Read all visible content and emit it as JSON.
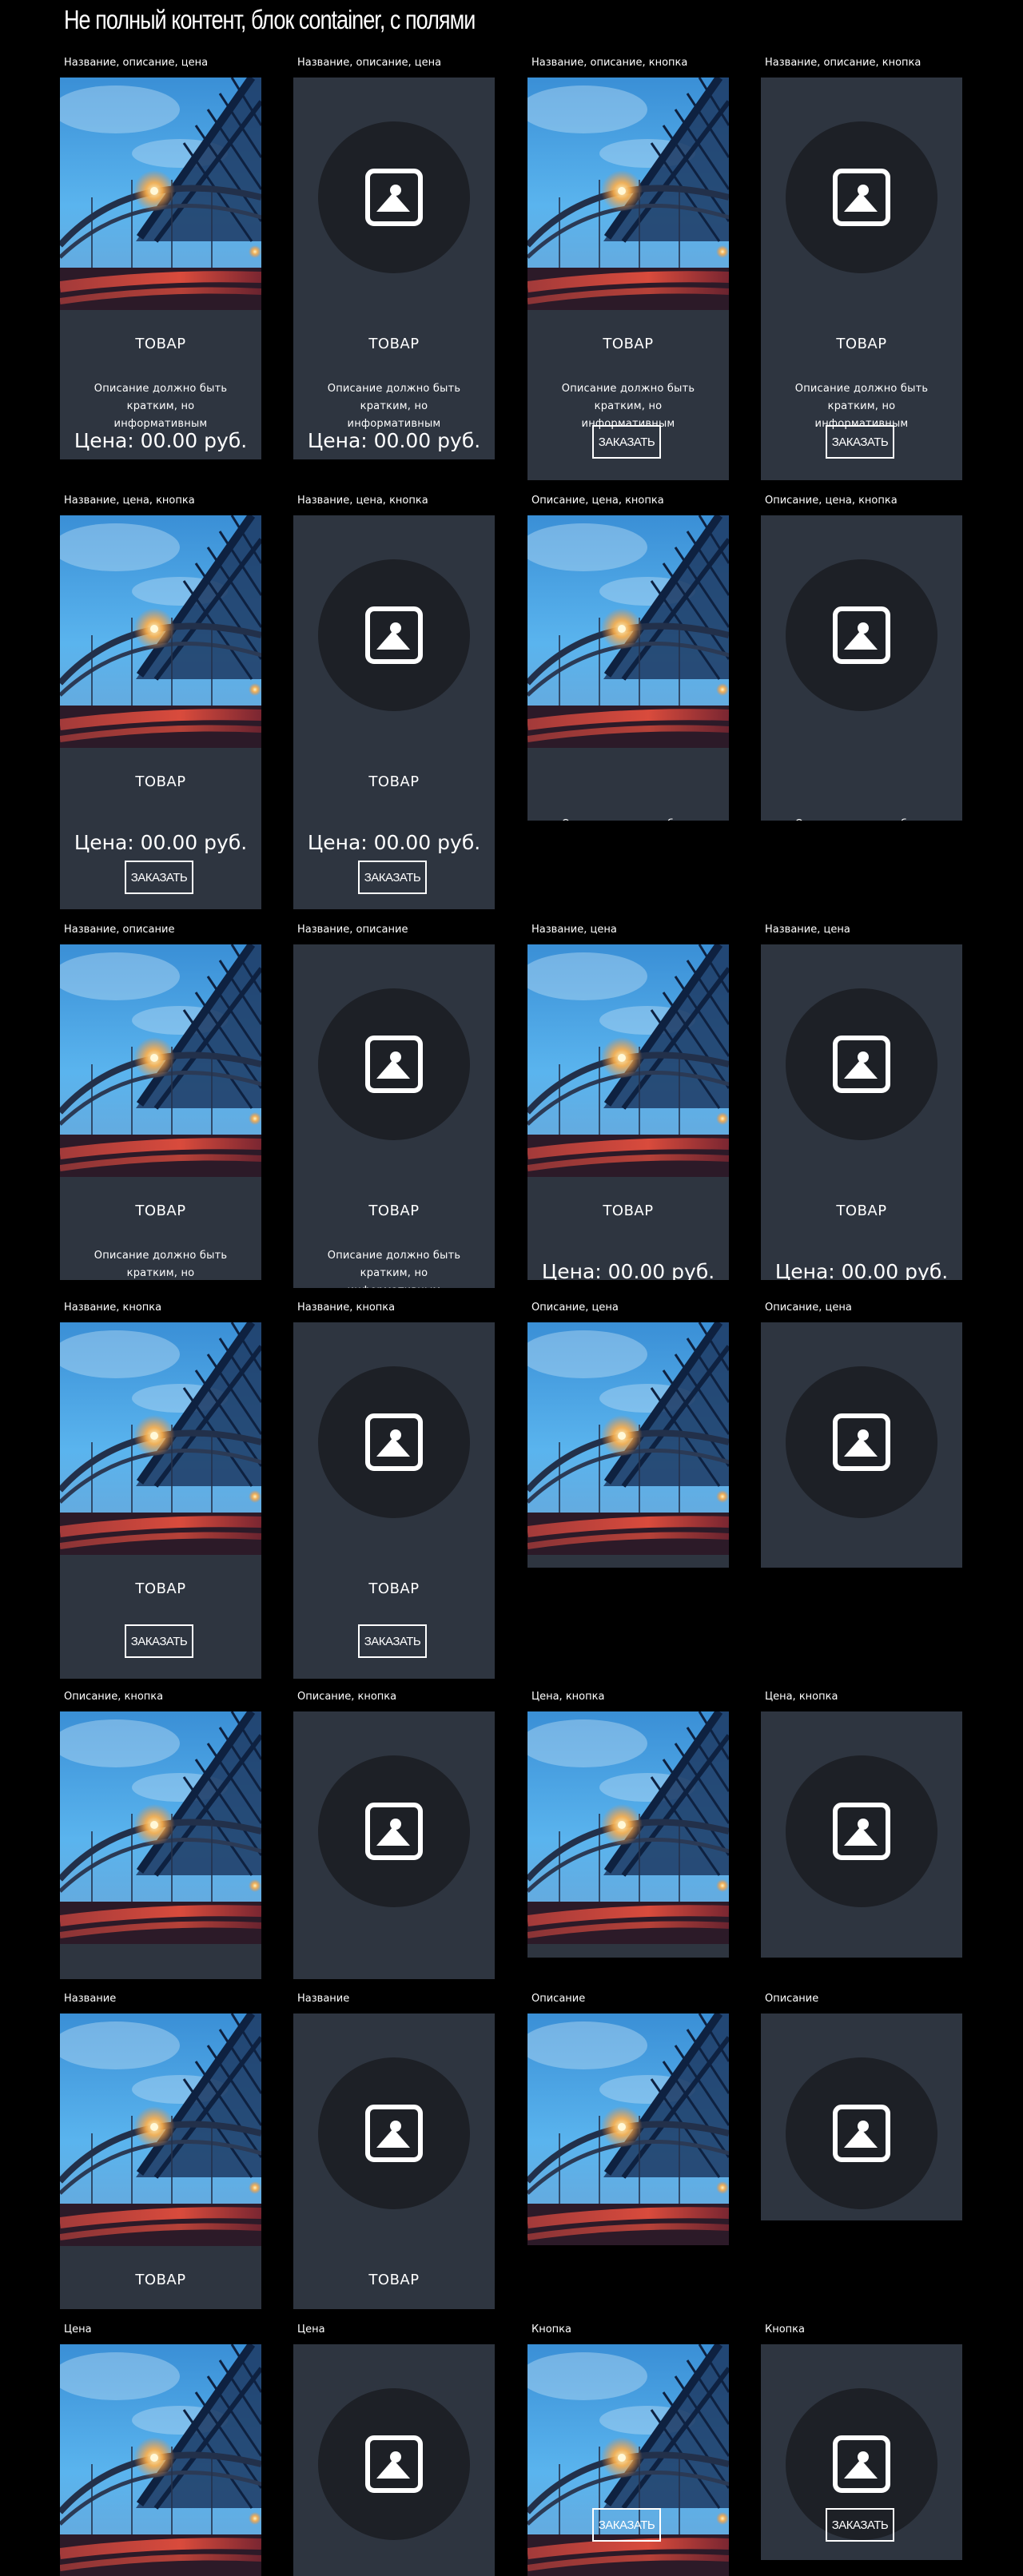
{
  "page": {
    "heading": "Не полный контент, блок container, с полями"
  },
  "product": {
    "title": "ТОВАР",
    "description": "Описание должно быть кратким, но информативным",
    "price": "Цена: 00.00 руб.",
    "button": "ЗАКАЗАТЬ",
    "photo_icon": "bridge-photo",
    "placeholder_icon": "image-placeholder-icon"
  },
  "colors": {
    "card": "#2e3540",
    "placeholder_circle": "#1d2026",
    "page": "#000000"
  },
  "rows": [
    {
      "cells": [
        {
          "label": "Название, описание, цена",
          "media": "photo",
          "parts": [
            "title",
            "description",
            "price"
          ]
        },
        {
          "label": "Название, описание, цена",
          "media": "placeholder",
          "parts": [
            "title",
            "description",
            "price"
          ]
        },
        {
          "label": "Название, описание, кнопка",
          "media": "photo",
          "parts": [
            "title",
            "description",
            "button"
          ]
        },
        {
          "label": "Название, описание, кнопка",
          "media": "placeholder",
          "parts": [
            "title",
            "description",
            "button"
          ]
        }
      ]
    },
    {
      "cells": [
        {
          "label": "Название, цена, кнопка",
          "media": "photo",
          "parts": [
            "title",
            "price",
            "button"
          ]
        },
        {
          "label": "Название, цена, кнопка",
          "media": "placeholder",
          "parts": [
            "title",
            "price",
            "button"
          ]
        },
        {
          "label": "Описание, цена, кнопка",
          "media": "photo",
          "parts": [
            "description",
            "price",
            "button"
          ]
        },
        {
          "label": "Описание, цена, кнопка",
          "media": "placeholder",
          "parts": [
            "description",
            "price",
            "button"
          ]
        }
      ]
    },
    {
      "cells": [
        {
          "label": "Название, описание",
          "media": "photo",
          "parts": [
            "title",
            "description"
          ]
        },
        {
          "label": "Название, описание",
          "media": "placeholder",
          "parts": [
            "title",
            "description"
          ]
        },
        {
          "label": "Название, цена",
          "media": "photo",
          "parts": [
            "title",
            "price"
          ]
        },
        {
          "label": "Название, цена",
          "media": "placeholder",
          "parts": [
            "title",
            "price"
          ]
        }
      ]
    },
    {
      "cells": [
        {
          "label": "Название, кнопка",
          "media": "photo",
          "parts": [
            "title",
            "button"
          ]
        },
        {
          "label": "Название, кнопка",
          "media": "placeholder",
          "parts": [
            "title",
            "button"
          ]
        },
        {
          "label": "Описание, цена",
          "media": "photo",
          "parts": [
            "description",
            "price"
          ]
        },
        {
          "label": "Описание, цена",
          "media": "placeholder",
          "parts": [
            "description",
            "price"
          ]
        }
      ]
    },
    {
      "cells": [
        {
          "label": "Описание, кнопка",
          "media": "photo",
          "parts": [
            "description",
            "button"
          ]
        },
        {
          "label": "Описание, кнопка",
          "media": "placeholder",
          "parts": [
            "description",
            "button"
          ]
        },
        {
          "label": "Цена, кнопка",
          "media": "photo",
          "parts": [
            "price",
            "button"
          ]
        },
        {
          "label": "Цена, кнопка",
          "media": "placeholder",
          "parts": [
            "price",
            "button"
          ]
        }
      ]
    },
    {
      "cells": [
        {
          "label": "Название",
          "media": "photo",
          "parts": [
            "title"
          ]
        },
        {
          "label": "Название",
          "media": "placeholder",
          "parts": [
            "title"
          ]
        },
        {
          "label": "Описание",
          "media": "photo",
          "parts": [
            "description"
          ]
        },
        {
          "label": "Описание",
          "media": "placeholder",
          "parts": [
            "description"
          ]
        }
      ]
    },
    {
      "cells": [
        {
          "label": "Цена",
          "media": "photo",
          "parts": [
            "price"
          ]
        },
        {
          "label": "Цена",
          "media": "placeholder",
          "parts": [
            "price"
          ]
        },
        {
          "label": "Кнопка",
          "media": "photo",
          "parts": [
            "button"
          ]
        },
        {
          "label": "Кнопка",
          "media": "placeholder",
          "parts": [
            "button"
          ]
        }
      ]
    }
  ]
}
